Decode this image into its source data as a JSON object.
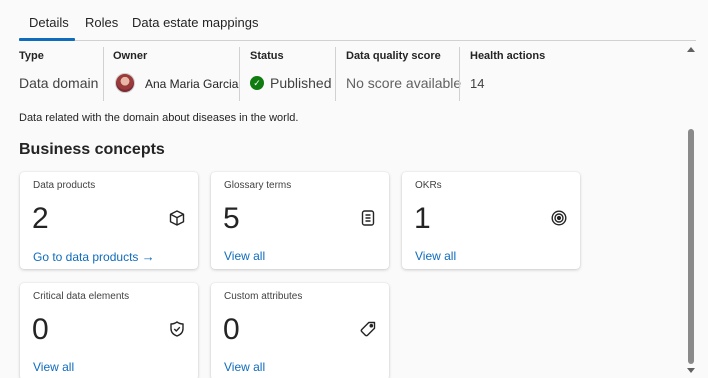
{
  "tabs": [
    {
      "label": "Details",
      "active": true
    },
    {
      "label": "Roles",
      "active": false
    },
    {
      "label": "Data estate mappings",
      "active": false
    }
  ],
  "summary": {
    "type": {
      "label": "Type",
      "value": "Data domain"
    },
    "owner": {
      "label": "Owner",
      "value": "Ana Maria Garcia"
    },
    "status": {
      "label": "Status",
      "value": "Published",
      "icon": "checkmark-circle-icon",
      "color": "#107c10"
    },
    "quality": {
      "label": "Data quality score",
      "value": "No score available"
    },
    "health": {
      "label": "Health actions",
      "value": "14"
    }
  },
  "description": "Data related with the domain about diseases in the world.",
  "section_title": "Business concepts",
  "cards": [
    {
      "title": "Data products",
      "count": "2",
      "link": "Go to data products",
      "icon": "cube-icon"
    },
    {
      "title": "Glossary terms",
      "count": "5",
      "link": "View all",
      "icon": "document-icon"
    },
    {
      "title": "OKRs",
      "count": "1",
      "link": "View all",
      "icon": "target-icon"
    },
    {
      "title": "Critical data elements",
      "count": "0",
      "link": "View all",
      "icon": "shield-check-icon"
    },
    {
      "title": "Custom attributes",
      "count": "0",
      "link": "View all",
      "icon": "tag-icon"
    }
  ],
  "colors": {
    "accent": "#0f6cbd",
    "success": "#107c10"
  }
}
